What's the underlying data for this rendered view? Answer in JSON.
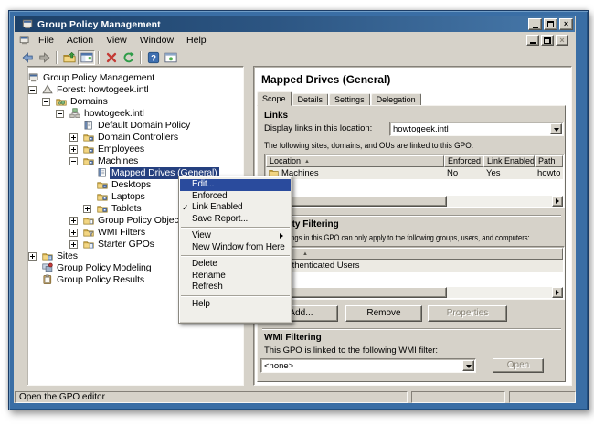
{
  "window": {
    "title": "Group Policy Management"
  },
  "menubar": {
    "items": [
      "File",
      "Action",
      "View",
      "Window",
      "Help"
    ]
  },
  "toolbar": {
    "icons": [
      {
        "name": "back-icon"
      },
      {
        "name": "forward-icon"
      },
      {
        "name": "separator"
      },
      {
        "name": "up-level-icon"
      },
      {
        "name": "console-tree-toggle-icon",
        "pressed": true
      },
      {
        "name": "separator2"
      },
      {
        "name": "delete-icon"
      },
      {
        "name": "refresh-icon"
      },
      {
        "name": "separator3"
      },
      {
        "name": "help-icon"
      },
      {
        "name": "new-window-icon"
      }
    ]
  },
  "tree": {
    "items": [
      {
        "label": "Group Policy Management",
        "level": 0,
        "icon": "console"
      },
      {
        "label": "Forest: howtogeek.intl",
        "level": 1,
        "icon": "forest",
        "expander": "minus"
      },
      {
        "label": "Domains",
        "level": 2,
        "icon": "domains",
        "expander": "minus"
      },
      {
        "label": "howtogeek.intl",
        "level": 3,
        "icon": "domain",
        "expander": "minus"
      },
      {
        "label": "Default Domain Policy",
        "level": 4,
        "icon": "gpo"
      },
      {
        "label": "Domain Controllers",
        "level": 4,
        "icon": "ou",
        "expander": "plus"
      },
      {
        "label": "Employees",
        "level": 4,
        "icon": "ou",
        "expander": "plus"
      },
      {
        "label": "Machines",
        "level": 4,
        "icon": "ou",
        "expander": "minus"
      },
      {
        "label": "Mapped Drives (General)",
        "level": 5,
        "icon": "gpo",
        "selected": true
      },
      {
        "label": "Desktops",
        "level": 5,
        "icon": "ou"
      },
      {
        "label": "Laptops",
        "level": 5,
        "icon": "ou"
      },
      {
        "label": "Tablets",
        "level": 5,
        "icon": "ou",
        "expander": "plus"
      },
      {
        "label": "Group Policy Objects",
        "level": 4,
        "icon": "gpofolder",
        "expander": "plus"
      },
      {
        "label": "WMI Filters",
        "level": 4,
        "icon": "wmi",
        "expander": "plus"
      },
      {
        "label": "Starter GPOs",
        "level": 4,
        "icon": "startergpo",
        "expander": "plus"
      },
      {
        "label": "Sites",
        "level": 1,
        "icon": "sites",
        "expander": "plus"
      },
      {
        "label": "Group Policy Modeling",
        "level": 1,
        "icon": "modeling"
      },
      {
        "label": "Group Policy Results",
        "level": 1,
        "icon": "results"
      }
    ]
  },
  "context_menu": {
    "items": [
      {
        "label": "Edit...",
        "highlighted": true
      },
      {
        "label": "Enforced"
      },
      {
        "label": "Link Enabled",
        "checked": true
      },
      {
        "label": "Save Report..."
      },
      {
        "separator": true
      },
      {
        "label": "View",
        "submenu": true
      },
      {
        "label": "New Window from Here"
      },
      {
        "separator": true
      },
      {
        "label": "Delete"
      },
      {
        "label": "Rename"
      },
      {
        "label": "Refresh"
      },
      {
        "separator": true
      },
      {
        "label": "Help"
      }
    ]
  },
  "panel": {
    "title": "Mapped Drives (General)",
    "tabs": [
      {
        "label": "Scope",
        "active": true
      },
      {
        "label": "Details"
      },
      {
        "label": "Settings"
      },
      {
        "label": "Delegation"
      }
    ],
    "links": {
      "heading": "Links",
      "display_label": "Display links in this location:",
      "location_value": "howtogeek.intl",
      "description": "The following sites, domains, and OUs are linked to this GPO:",
      "columns": [
        "Location",
        "Enforced",
        "Link Enabled",
        "Path"
      ],
      "rows": [
        {
          "location": "Machines",
          "enforced": "No",
          "link_enabled": "Yes",
          "path": "howto"
        }
      ]
    },
    "security": {
      "heading": "Security Filtering",
      "description": "The settings in this GPO can only apply to the following groups, users, and computers:",
      "rows": [
        {
          "name": "Authenticated Users"
        }
      ],
      "buttons": [
        {
          "label": "Add...",
          "enabled": true
        },
        {
          "label": "Remove",
          "enabled": true
        },
        {
          "label": "Properties",
          "enabled": false
        }
      ]
    },
    "wmi": {
      "heading": "WMI Filtering",
      "description": "This GPO is linked to the following WMI filter:",
      "filter_value": "<none>",
      "open_label": "Open"
    }
  },
  "statusbar": {
    "text": "Open the GPO editor"
  },
  "colors": {
    "titlebar_start": "#1d4169",
    "titlebar_end": "#4779ab",
    "window_border": "#3a6ea5",
    "menu_highlight": "#2a4b9d",
    "tree_selection": "#25407f",
    "face": "#d6d2c9"
  }
}
